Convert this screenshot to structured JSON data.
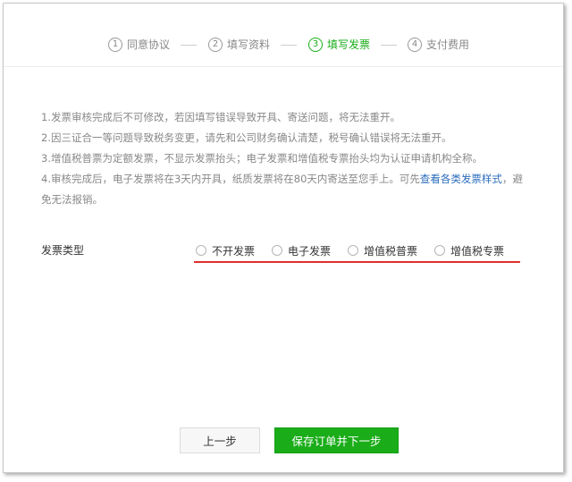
{
  "steps": [
    {
      "num": "1",
      "label": "同意协议"
    },
    {
      "num": "2",
      "label": "填写资料"
    },
    {
      "num": "3",
      "label": "填写发票"
    },
    {
      "num": "4",
      "label": "支付费用"
    }
  ],
  "active_step": 3,
  "notes": {
    "line1": "1.发票审核完成后不可修改，若因填写错误导致开具、寄送问题，将无法重开。",
    "line2": "2.因三证合一等问题导致税务变更，请先和公司财务确认清楚，税号确认错误将无法重开。",
    "line3": "3.增值税普票为定额发票，不显示发票抬头；电子发票和增值税专票抬头均为认证申请机构全称。",
    "line4_prefix": "4.审核完成后，电子发票将在3天内开具，纸质发票将在80天内寄送至您手上。可先",
    "line4_link": "查看各类发票样式",
    "line4_suffix": "，避免无法报销。"
  },
  "invoice_type": {
    "label": "发票类型",
    "options": [
      "不开发票",
      "电子发票",
      "增值税普票",
      "增值税专票"
    ]
  },
  "buttons": {
    "prev": "上一步",
    "next": "保存订单并下一步"
  },
  "colors": {
    "accent": "#1aad19",
    "link": "#2b6dbd",
    "highlight_underline": "#e0302b"
  }
}
